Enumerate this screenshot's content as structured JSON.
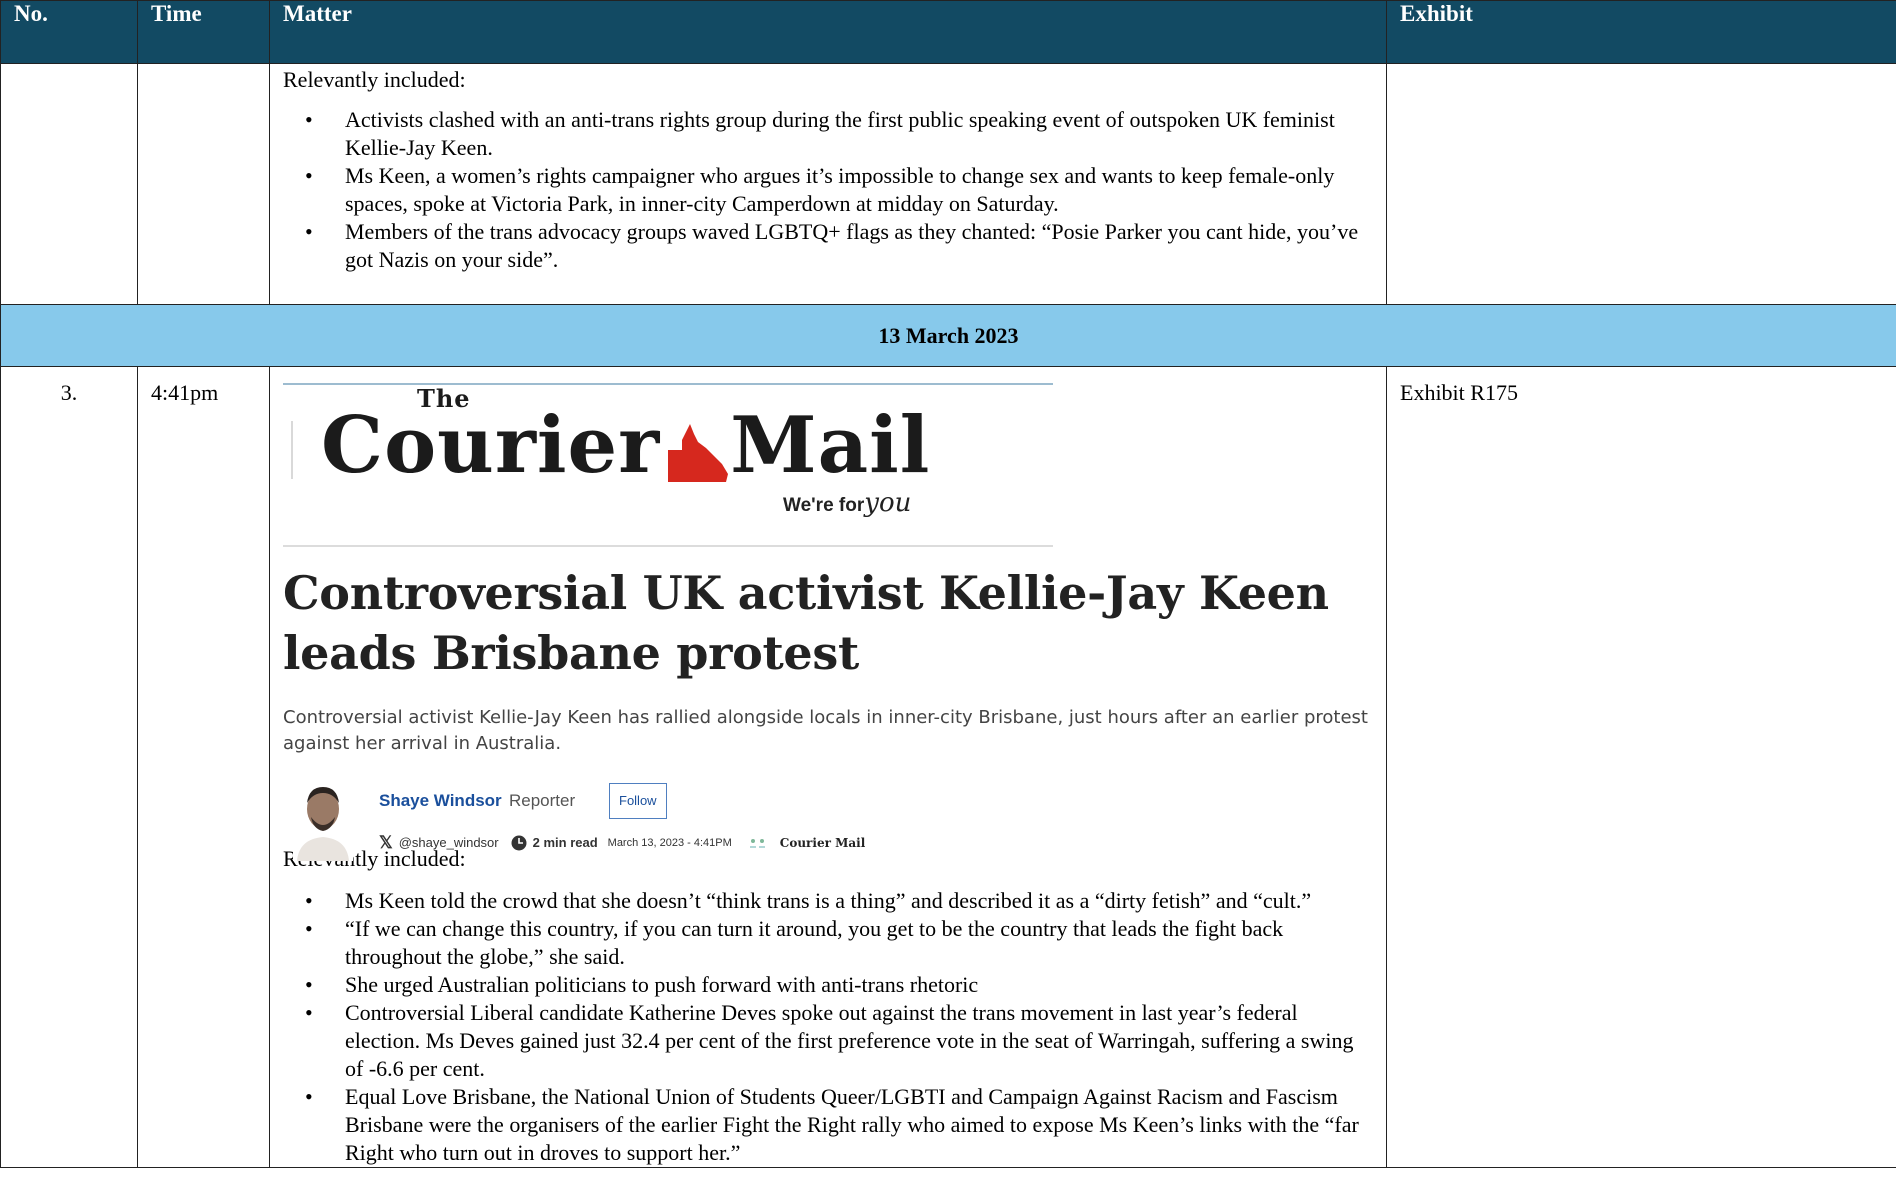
{
  "columns": [
    "No.",
    "Time",
    "Matter",
    "Exhibit"
  ],
  "rows": [
    {
      "no": "",
      "time": "",
      "lead": "Relevantly included:",
      "bullets": [
        "Activists clashed with an anti-trans rights group during the first public speaking event of outspoken UK feminist Kellie-Jay Keen.",
        "Ms Keen, a women’s rights campaigner who argues it’s impossible to change sex and wants to keep female-only spaces, spoke at Victoria Park, in inner-city Camperdown at midday on Saturday.",
        "Members of the trans advocacy groups waved LGBTQ+ flags as they chanted: “Posie Parker you cant hide, you’ve got Nazis on your side”."
      ],
      "exhibit": ""
    },
    {
      "no": "3.",
      "time": "4:41pm",
      "lead": "Relevantly included:",
      "bullets": [
        "Ms Keen told the crowd that she doesn’t “think trans is a thing” and described it as a “dirty fetish” and “cult.”",
        "“If we can change this country, if you can turn it around, you get to be the country that leads the fight back throughout the globe,” she said.",
        "She urged Australian politicians to push forward with anti-trans rhetoric",
        "Controversial Liberal candidate Katherine Deves spoke out against the trans movement in last year’s federal election. Ms Deves gained just 32.4 per cent of the first preference vote in the seat of Warringah, suffering a swing of -6.6 per cent.",
        "Equal Love Brisbane, the National Union of Students Queer/LGBTI and Campaign Against Racism and Fascism Brisbane were the organisers of the earlier Fight the Right rally who aimed to expose Ms Keen’s links with the “far Right who turn out in droves to support her.”"
      ],
      "exhibit": "Exhibit R175"
    }
  ],
  "date_row": "13 March 2023",
  "bullet_glyph": "•",
  "article": {
    "masthead_the": "The",
    "masthead_word_a": "Courier",
    "masthead_word_b": "Mail",
    "tagline_a": "We're for",
    "tagline_b": "you",
    "headline": "Controversial UK activist Kellie-Jay Keen leads Brisbane protest",
    "standfirst": "Controversial activist Kellie-Jay Keen has rallied alongside locals in inner-city Brisbane, just hours after an earlier protest against her arrival in Australia.",
    "author": "Shaye Windsor",
    "role": "Reporter",
    "follow": "Follow",
    "x_glyph": "𝕏",
    "handle": "@shaye_windsor",
    "read_time": "2 min read",
    "datetime": "March 13, 2023 - 4:41PM",
    "brand_small": "Courier Mail",
    "brand_color": "#d6281e",
    "accent_color": "#124a63",
    "date_row_color": "#87c9eb"
  }
}
